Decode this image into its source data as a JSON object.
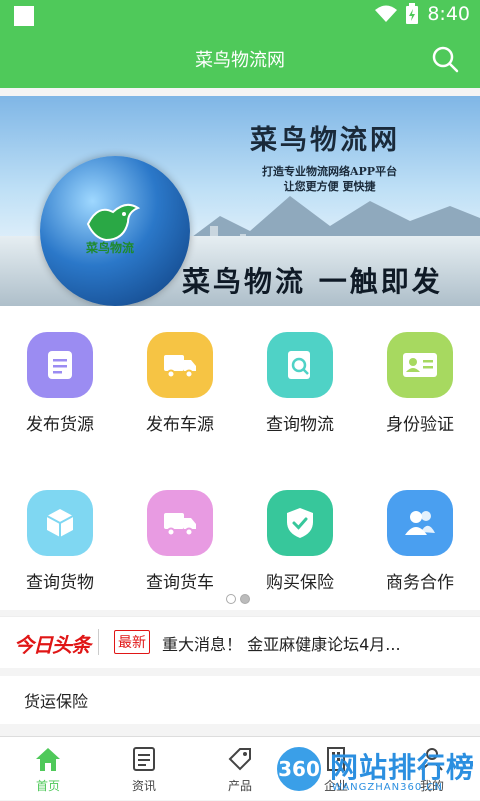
{
  "status_bar": {
    "time": "8:40",
    "icons": [
      "notification-square-icon",
      "wifi-icon",
      "battery-charging-icon"
    ]
  },
  "app_bar": {
    "title": "菜鸟物流网",
    "search_icon": "search-icon"
  },
  "banner": {
    "title": "菜鸟物流网",
    "subtitle_line1": "打造专业物流网络APP平台",
    "subtitle_line2": "让您更方便 更快捷",
    "slogan": "菜鸟物流 一触即发",
    "logo_text": "菜鸟物流"
  },
  "grid": [
    {
      "label": "发布货源",
      "icon": "document-icon",
      "color": "#9b8cf2"
    },
    {
      "label": "发布车源",
      "icon": "truck-icon",
      "color": "#f6c444"
    },
    {
      "label": "查询物流",
      "icon": "search-document-icon",
      "color": "#4fd2c6"
    },
    {
      "label": "身份验证",
      "icon": "id-card-icon",
      "color": "#a7d960"
    },
    {
      "label": "查询货物",
      "icon": "box-icon",
      "color": "#7fd7f2"
    },
    {
      "label": "查询货车",
      "icon": "truck-icon",
      "color": "#e89be2"
    },
    {
      "label": "购买保险",
      "icon": "shield-check-icon",
      "color": "#37c79b"
    },
    {
      "label": "商务合作",
      "icon": "people-icon",
      "color": "#4a9ff0"
    }
  ],
  "pager": {
    "pages": 2,
    "active": 2
  },
  "news": {
    "brand": "今日头条",
    "tag": "最新",
    "headline": "重大消息！ 金亚麻健康论坛4月..."
  },
  "section": {
    "title": "货运保险"
  },
  "tabs": [
    {
      "label": "首页",
      "icon": "home-icon",
      "active": true
    },
    {
      "label": "资讯",
      "icon": "news-icon",
      "active": false
    },
    {
      "label": "产品",
      "icon": "tag-icon",
      "active": false
    },
    {
      "label": "企业",
      "icon": "building-icon",
      "active": false
    },
    {
      "label": "我的",
      "icon": "user-icon",
      "active": false
    }
  ],
  "watermark": {
    "badge": "360",
    "text": "网站排行榜",
    "url": "WANGZHAN360.CN"
  }
}
